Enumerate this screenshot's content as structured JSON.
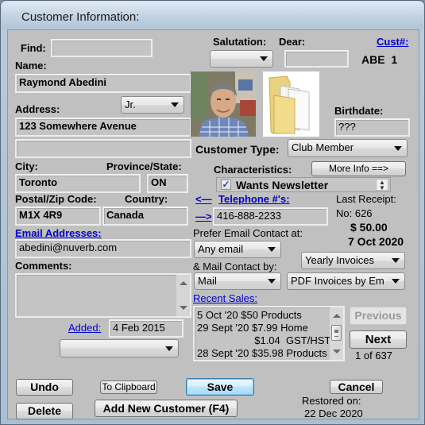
{
  "window": {
    "title": "Customer Information:"
  },
  "find": {
    "label": "Find:",
    "value": ""
  },
  "name": {
    "label": "Name:",
    "value": "Raymond Abedini"
  },
  "suffix": {
    "value": "Jr."
  },
  "salutation": {
    "label": "Salutation:",
    "value": ""
  },
  "dear": {
    "label": "Dear:",
    "value": ""
  },
  "cust": {
    "link": "Cust#:",
    "value": "ABE  1"
  },
  "address": {
    "label": "Address:",
    "line1": "123 Somewhere Avenue",
    "line2": ""
  },
  "city": {
    "label": "City:",
    "value": "Toronto"
  },
  "province": {
    "label": "Province/State:",
    "value": "ON"
  },
  "postal": {
    "label": "Postal/Zip Code:",
    "value": "M1X 4R9"
  },
  "country": {
    "label": "Country:",
    "value": "Canada"
  },
  "email": {
    "link": "Email Addresses:",
    "value": "abedini@nuverb.com"
  },
  "comments": {
    "label": "Comments:",
    "value": ""
  },
  "added": {
    "link": "Added:",
    "value": "4 Feb 2015",
    "dropdown_value": ""
  },
  "birthdate": {
    "label": "Birthdate:",
    "value": "???"
  },
  "customer_type": {
    "label": "Customer Type:",
    "value": "Club Member"
  },
  "characteristics": {
    "label": "Characteristics:",
    "more_info_label": "More Info ==>",
    "checkbox_label": "Wants Newsletter",
    "checked": true,
    "check_glyph": "✓"
  },
  "telephone": {
    "prev_arrow": "<—",
    "link": "Telephone #'s:",
    "next_arrow": "—>",
    "value": "416-888-2233"
  },
  "last_receipt": {
    "label": "Last Receipt:",
    "number": "No: 626",
    "amount": "$ 50.00",
    "date": "7 Oct 2020"
  },
  "contact": {
    "email_label": "Prefer Email Contact at:",
    "email_value": "Any email",
    "mail_label": "& Mail Contact by:",
    "mail_value": "Mail",
    "invoice_freq": "Yearly Invoices",
    "invoice_method": "PDF Invoices by Em"
  },
  "recent_sales": {
    "link": "Recent Sales:",
    "lines": [
      "5 Oct '20  $50  Products",
      "29 Sept '20  $7.99  Home",
      "                    $1.04  GST/HST",
      "28 Sept '20  $35.98  Products"
    ]
  },
  "nav": {
    "previous_label": "Previous",
    "next_label": "Next",
    "position": "1 of 637"
  },
  "buttons": {
    "undo": "Undo",
    "delete": "Delete",
    "clipboard": "To Clipboard",
    "add_new": "Add New Customer (F4)",
    "save": "Save",
    "cancel": "Cancel"
  },
  "restored": {
    "label": "Restored on:",
    "date": "22 Dec 2020"
  }
}
